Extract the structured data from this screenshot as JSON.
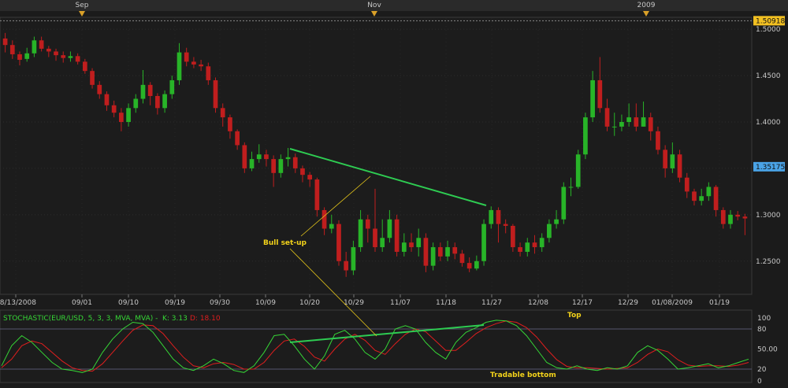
{
  "chart_data": [
    {
      "type": "candlestick",
      "instrument": "EUR/USD",
      "month_markers": [
        "Sep",
        "Nov",
        "2009"
      ],
      "x_tick_labels": [
        "08/13/2008",
        "09/01",
        "09/10",
        "09/19",
        "09/30",
        "10/09",
        "10/20",
        "10/29",
        "11/07",
        "11/18",
        "11/27",
        "12/08",
        "12/17",
        "12/29",
        "01/08/2009",
        "01/19"
      ],
      "y_tick_labels": [
        "1.2500",
        "1.3000",
        "1.3500",
        "1.4000",
        "1.4500",
        "1.5000"
      ],
      "ylim": [
        1.215,
        1.512
      ],
      "high_marker": "1.50918",
      "last_price_marker": "1.35175",
      "high_value": 1.50918,
      "last_value": 1.35175,
      "candles": [
        [
          1.49,
          1.483,
          1.496,
          1.475
        ],
        [
          1.483,
          1.473,
          1.488,
          1.468
        ],
        [
          1.473,
          1.467,
          1.476,
          1.461
        ],
        [
          1.468,
          1.474,
          1.48,
          1.465
        ],
        [
          1.474,
          1.488,
          1.492,
          1.47
        ],
        [
          1.488,
          1.479,
          1.492,
          1.476
        ],
        [
          1.479,
          1.476,
          1.482,
          1.47
        ],
        [
          1.476,
          1.472,
          1.479,
          1.466
        ],
        [
          1.472,
          1.469,
          1.476,
          1.464
        ],
        [
          1.469,
          1.471,
          1.476,
          1.465
        ],
        [
          1.471,
          1.465,
          1.474,
          1.462
        ],
        [
          1.465,
          1.455,
          1.468,
          1.452
        ],
        [
          1.455,
          1.44,
          1.458,
          1.436
        ],
        [
          1.44,
          1.43,
          1.444,
          1.425
        ],
        [
          1.43,
          1.418,
          1.433,
          1.412
        ],
        [
          1.418,
          1.41,
          1.423,
          1.405
        ],
        [
          1.41,
          1.4,
          1.415,
          1.39
        ],
        [
          1.4,
          1.415,
          1.42,
          1.395
        ],
        [
          1.415,
          1.425,
          1.43,
          1.41
        ],
        [
          1.425,
          1.44,
          1.456,
          1.42
        ],
        [
          1.44,
          1.428,
          1.443,
          1.418
        ],
        [
          1.428,
          1.415,
          1.431,
          1.408
        ],
        [
          1.415,
          1.43,
          1.434,
          1.41
        ],
        [
          1.43,
          1.445,
          1.45,
          1.425
        ],
        [
          1.445,
          1.475,
          1.485,
          1.44
        ],
        [
          1.475,
          1.465,
          1.48,
          1.46
        ],
        [
          1.465,
          1.462,
          1.47,
          1.458
        ],
        [
          1.462,
          1.46,
          1.467,
          1.455
        ],
        [
          1.46,
          1.445,
          1.464,
          1.44
        ],
        [
          1.445,
          1.415,
          1.448,
          1.41
        ],
        [
          1.415,
          1.405,
          1.42,
          1.395
        ],
        [
          1.405,
          1.39,
          1.408,
          1.382
        ],
        [
          1.39,
          1.375,
          1.392,
          1.37
        ],
        [
          1.375,
          1.35,
          1.378,
          1.345
        ],
        [
          1.35,
          1.36,
          1.368,
          1.347
        ],
        [
          1.36,
          1.365,
          1.376,
          1.356
        ],
        [
          1.365,
          1.36,
          1.37,
          1.352
        ],
        [
          1.36,
          1.345,
          1.364,
          1.33
        ],
        [
          1.345,
          1.36,
          1.365,
          1.34
        ],
        [
          1.36,
          1.362,
          1.372,
          1.352
        ],
        [
          1.362,
          1.35,
          1.366,
          1.345
        ],
        [
          1.35,
          1.343,
          1.353,
          1.335
        ],
        [
          1.343,
          1.338,
          1.346,
          1.33
        ],
        [
          1.338,
          1.305,
          1.34,
          1.298
        ],
        [
          1.305,
          1.285,
          1.308,
          1.278
        ],
        [
          1.285,
          1.29,
          1.3,
          1.28
        ],
        [
          1.29,
          1.25,
          1.294,
          1.245
        ],
        [
          1.25,
          1.24,
          1.26,
          1.233
        ],
        [
          1.24,
          1.265,
          1.272,
          1.235
        ],
        [
          1.265,
          1.295,
          1.305,
          1.26
        ],
        [
          1.295,
          1.285,
          1.3,
          1.27
        ],
        [
          1.285,
          1.265,
          1.328,
          1.26
        ],
        [
          1.265,
          1.275,
          1.295,
          1.26
        ],
        [
          1.275,
          1.295,
          1.305,
          1.27
        ],
        [
          1.295,
          1.26,
          1.3,
          1.255
        ],
        [
          1.26,
          1.27,
          1.28,
          1.255
        ],
        [
          1.27,
          1.265,
          1.28,
          1.26
        ],
        [
          1.265,
          1.275,
          1.285,
          1.255
        ],
        [
          1.275,
          1.245,
          1.28,
          1.238
        ],
        [
          1.245,
          1.265,
          1.27,
          1.24
        ],
        [
          1.265,
          1.255,
          1.27,
          1.25
        ],
        [
          1.255,
          1.265,
          1.272,
          1.25
        ],
        [
          1.265,
          1.258,
          1.27,
          1.252
        ],
        [
          1.258,
          1.248,
          1.262,
          1.244
        ],
        [
          1.248,
          1.242,
          1.254,
          1.238
        ],
        [
          1.242,
          1.25,
          1.256,
          1.24
        ],
        [
          1.25,
          1.29,
          1.295,
          1.245
        ],
        [
          1.29,
          1.305,
          1.309,
          1.285
        ],
        [
          1.305,
          1.29,
          1.308,
          1.27
        ],
        [
          1.29,
          1.288,
          1.295,
          1.28
        ],
        [
          1.288,
          1.265,
          1.29,
          1.26
        ],
        [
          1.265,
          1.26,
          1.27,
          1.255
        ],
        [
          1.26,
          1.27,
          1.275,
          1.255
        ],
        [
          1.27,
          1.265,
          1.278,
          1.258
        ],
        [
          1.265,
          1.275,
          1.28,
          1.26
        ],
        [
          1.275,
          1.29,
          1.295,
          1.27
        ],
        [
          1.29,
          1.295,
          1.305,
          1.285
        ],
        [
          1.295,
          1.33,
          1.335,
          1.29
        ],
        [
          1.33,
          1.33,
          1.34,
          1.32
        ],
        [
          1.33,
          1.365,
          1.37,
          1.328
        ],
        [
          1.365,
          1.405,
          1.41,
          1.36
        ],
        [
          1.405,
          1.445,
          1.455,
          1.4
        ],
        [
          1.445,
          1.415,
          1.47,
          1.41
        ],
        [
          1.415,
          1.395,
          1.425,
          1.39
        ],
        [
          1.395,
          1.395,
          1.41,
          1.385
        ],
        [
          1.395,
          1.4,
          1.408,
          1.39
        ],
        [
          1.4,
          1.405,
          1.42,
          1.395
        ],
        [
          1.405,
          1.395,
          1.42,
          1.39
        ],
        [
          1.395,
          1.405,
          1.422,
          1.395
        ],
        [
          1.405,
          1.39,
          1.41,
          1.38
        ],
        [
          1.39,
          1.37,
          1.395,
          1.365
        ],
        [
          1.37,
          1.35,
          1.375,
          1.34
        ],
        [
          1.35,
          1.365,
          1.378,
          1.345
        ],
        [
          1.365,
          1.34,
          1.37,
          1.335
        ],
        [
          1.34,
          1.325,
          1.345,
          1.318
        ],
        [
          1.325,
          1.315,
          1.328,
          1.31
        ],
        [
          1.315,
          1.32,
          1.328,
          1.31
        ],
        [
          1.32,
          1.33,
          1.335,
          1.315
        ],
        [
          1.33,
          1.305,
          1.332,
          1.298
        ],
        [
          1.305,
          1.29,
          1.308,
          1.285
        ],
        [
          1.29,
          1.3,
          1.305,
          1.285
        ],
        [
          1.3,
          1.298,
          1.304,
          1.294
        ],
        [
          1.298,
          1.296,
          1.301,
          1.278
        ]
      ]
    },
    {
      "type": "line",
      "legend_title": "STOCHASTIC(EUR/USD, 5, 3, 3, MVA, MVA) -",
      "k_label": "K: 3.13",
      "d_label": "D: 18.10",
      "y_tick_labels": [
        "100",
        "80",
        "50.00",
        "20",
        "0"
      ],
      "ylim": [
        0,
        100
      ],
      "k_values": [
        25,
        55,
        70,
        60,
        45,
        30,
        20,
        18,
        15,
        20,
        45,
        65,
        80,
        90,
        88,
        75,
        55,
        35,
        22,
        18,
        25,
        35,
        28,
        18,
        15,
        25,
        45,
        70,
        72,
        55,
        35,
        20,
        40,
        72,
        78,
        65,
        45,
        35,
        50,
        80,
        85,
        80,
        60,
        45,
        35,
        60,
        75,
        82,
        90,
        93,
        92,
        85,
        70,
        50,
        30,
        22,
        20,
        25,
        20,
        18,
        22,
        20,
        25,
        45,
        55,
        48,
        35,
        20,
        22,
        25,
        28,
        22,
        25,
        30,
        35
      ],
      "d_values": [
        22,
        35,
        55,
        62,
        58,
        45,
        32,
        22,
        18,
        17,
        28,
        45,
        62,
        78,
        86,
        85,
        73,
        55,
        38,
        25,
        22,
        28,
        30,
        27,
        20,
        20,
        30,
        48,
        62,
        65,
        54,
        38,
        32,
        50,
        65,
        72,
        63,
        48,
        42,
        58,
        72,
        80,
        76,
        62,
        48,
        48,
        60,
        73,
        82,
        88,
        92,
        90,
        82,
        68,
        50,
        34,
        24,
        22,
        22,
        21,
        20,
        21,
        22,
        30,
        42,
        50,
        46,
        34,
        26,
        24,
        25,
        25,
        24,
        26,
        30
      ]
    }
  ],
  "annotations": {
    "bull_setup": "Bull set-up",
    "top": "Top",
    "tradable_bottom": "Tradable bottom"
  },
  "colors": {
    "background": "#1b1b1b",
    "bull_candle": "#28b428",
    "bear_candle": "#c01e1e",
    "k_line": "#36d636",
    "d_line": "#e01e1e",
    "trendline": "#2ecc52",
    "annotation": "#f2d21a",
    "high_marker_bg": "#f2c022",
    "last_marker_bg": "#4aa3e6"
  }
}
